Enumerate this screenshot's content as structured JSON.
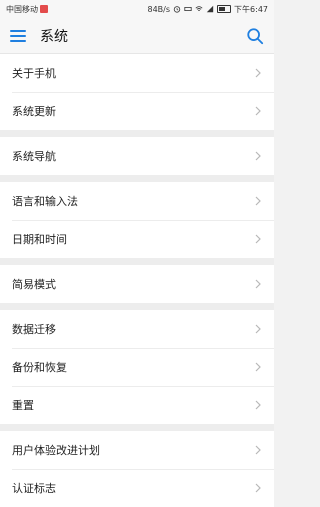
{
  "status_bar": {
    "carrier": "中国移动",
    "speed": "84B/s",
    "time": "下午6:47"
  },
  "app_bar": {
    "title": "系统"
  },
  "groups": [
    {
      "items": [
        {
          "label": "关于手机"
        },
        {
          "label": "系统更新"
        }
      ]
    },
    {
      "items": [
        {
          "label": "系统导航"
        }
      ]
    },
    {
      "items": [
        {
          "label": "语言和输入法"
        },
        {
          "label": "日期和时间"
        }
      ]
    },
    {
      "items": [
        {
          "label": "简易模式"
        }
      ]
    },
    {
      "items": [
        {
          "label": "数据迁移"
        },
        {
          "label": "备份和恢复"
        },
        {
          "label": "重置"
        }
      ]
    },
    {
      "items": [
        {
          "label": "用户体验改进计划"
        },
        {
          "label": "认证标志"
        }
      ]
    }
  ],
  "colors": {
    "accent": "#1f7fe0",
    "background": "#f2f2f2",
    "chevron": "#b8b8b8"
  }
}
